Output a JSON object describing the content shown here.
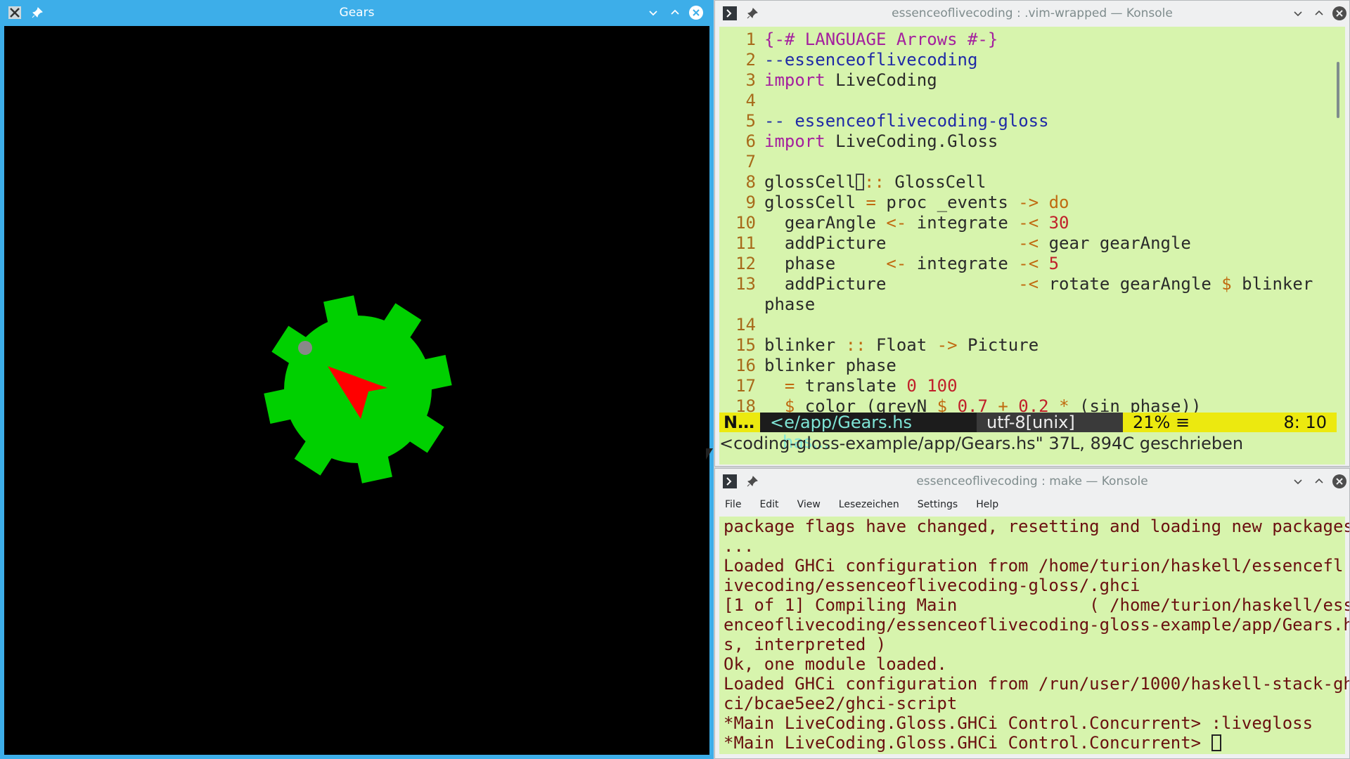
{
  "gears_window": {
    "title": "Gears"
  },
  "vim_window": {
    "title": "essenceoflivecoding : .vim-wrapped — Konsole",
    "lines": [
      {
        "n": "1",
        "parts": [
          [
            "kw",
            "{-# LANGUAGE Arrows #-}"
          ]
        ]
      },
      {
        "n": "2",
        "parts": [
          [
            "cm",
            "--essenceoflivecoding"
          ]
        ]
      },
      {
        "n": "3",
        "parts": [
          [
            "kw",
            "import"
          ],
          [
            "",
            " LiveCoding"
          ]
        ]
      },
      {
        "n": "4",
        "parts": []
      },
      {
        "n": "5",
        "parts": [
          [
            "cm",
            "-- essenceoflivecoding-gloss"
          ]
        ]
      },
      {
        "n": "6",
        "parts": [
          [
            "kw",
            "import"
          ],
          [
            "",
            " LiveCoding.Gloss"
          ]
        ]
      },
      {
        "n": "7",
        "parts": []
      },
      {
        "n": "8",
        "parts": [
          [
            "",
            "glossCell"
          ],
          [
            "cursor",
            ""
          ],
          [
            "op",
            "::"
          ],
          [
            "",
            " GlossCell"
          ]
        ]
      },
      {
        "n": "9",
        "parts": [
          [
            "",
            "glossCell "
          ],
          [
            "op",
            "="
          ],
          [
            "",
            " proc _events "
          ],
          [
            "op",
            "->"
          ],
          [
            "",
            " "
          ],
          [
            "op",
            "do"
          ]
        ]
      },
      {
        "n": "10",
        "parts": [
          [
            "",
            "  gearAngle "
          ],
          [
            "op",
            "<-"
          ],
          [
            "",
            " integrate "
          ],
          [
            "op",
            "-<"
          ],
          [
            "",
            " "
          ],
          [
            "num",
            "30"
          ]
        ]
      },
      {
        "n": "11",
        "parts": [
          [
            "",
            "  addPicture             "
          ],
          [
            "op",
            "-<"
          ],
          [
            "",
            " gear gearAngle"
          ]
        ]
      },
      {
        "n": "12",
        "parts": [
          [
            "",
            "  phase     "
          ],
          [
            "op",
            "<-"
          ],
          [
            "",
            " integrate "
          ],
          [
            "op",
            "-<"
          ],
          [
            "",
            " "
          ],
          [
            "num",
            "5"
          ]
        ]
      },
      {
        "n": "13",
        "parts": [
          [
            "",
            "  addPicture             "
          ],
          [
            "op",
            "-<"
          ],
          [
            "",
            " rotate gearAngle "
          ],
          [
            "op",
            "$"
          ],
          [
            "",
            " blinker"
          ]
        ]
      },
      {
        "n": "",
        "parts": [
          [
            "",
            "phase"
          ]
        ]
      },
      {
        "n": "14",
        "parts": []
      },
      {
        "n": "15",
        "parts": [
          [
            "",
            "blinker "
          ],
          [
            "op",
            "::"
          ],
          [
            "",
            " Float "
          ],
          [
            "op",
            "->"
          ],
          [
            "",
            " Picture"
          ]
        ]
      },
      {
        "n": "16",
        "parts": [
          [
            "",
            "blinker phase"
          ]
        ]
      },
      {
        "n": "17",
        "parts": [
          [
            "",
            "  "
          ],
          [
            "op",
            "="
          ],
          [
            "",
            " translate "
          ],
          [
            "num",
            "0"
          ],
          [
            "",
            " "
          ],
          [
            "num",
            "100"
          ]
        ]
      },
      {
        "n": "18",
        "parts": [
          [
            "",
            "  "
          ],
          [
            "op",
            "$"
          ],
          [
            "",
            " color (greyN "
          ],
          [
            "op",
            "$"
          ],
          [
            "",
            " "
          ],
          [
            "num",
            "0.7"
          ],
          [
            "",
            " "
          ],
          [
            "op",
            "+"
          ],
          [
            "",
            " "
          ],
          [
            "num",
            "0.2"
          ],
          [
            "",
            " "
          ],
          [
            "op",
            "*"
          ],
          [
            "",
            " (sin phase))"
          ]
        ]
      }
    ],
    "status": {
      "mode": "N…",
      "file": "<e/app/Gears.hs",
      "ft": "has…",
      "enc": "utf-8[unix]",
      "percent": "21% ≡",
      "pos": "8: 10"
    },
    "cmdline": "<coding-gloss-example/app/Gears.hs\" 37L, 894C geschrieben"
  },
  "make_window": {
    "title": "essenceoflivecoding : make — Konsole",
    "menu": [
      "File",
      "Edit",
      "View",
      "Lesezeichen",
      "Settings",
      "Help"
    ],
    "lines": [
      "package flags have changed, resetting and loading new packages",
      "...",
      "Loaded GHCi configuration from /home/turion/haskell/essencefl",
      "ivecoding/essenceoflivecoding-gloss/.ghci",
      "[1 of 1] Compiling Main             ( /home/turion/haskell/ess",
      "enceoflivecoding/essenceoflivecoding-gloss-example/app/Gears.h",
      "s, interpreted )",
      "Ok, one module loaded.",
      "Loaded GHCi configuration from /run/user/1000/haskell-stack-gh",
      "ci/bcae5ee2/ghci-script",
      "*Main LiveCoding.Gloss.GHCi Control.Concurrent> :livegloss",
      "*Main LiveCoding.Gloss.GHCi Control.Concurrent> "
    ]
  },
  "colors": {
    "gear": "#00d000",
    "pointer": "#ff0000",
    "blinker": "#888888",
    "terminal_bg": "#d7f4ad",
    "titlebar_active": "#3daee9"
  }
}
